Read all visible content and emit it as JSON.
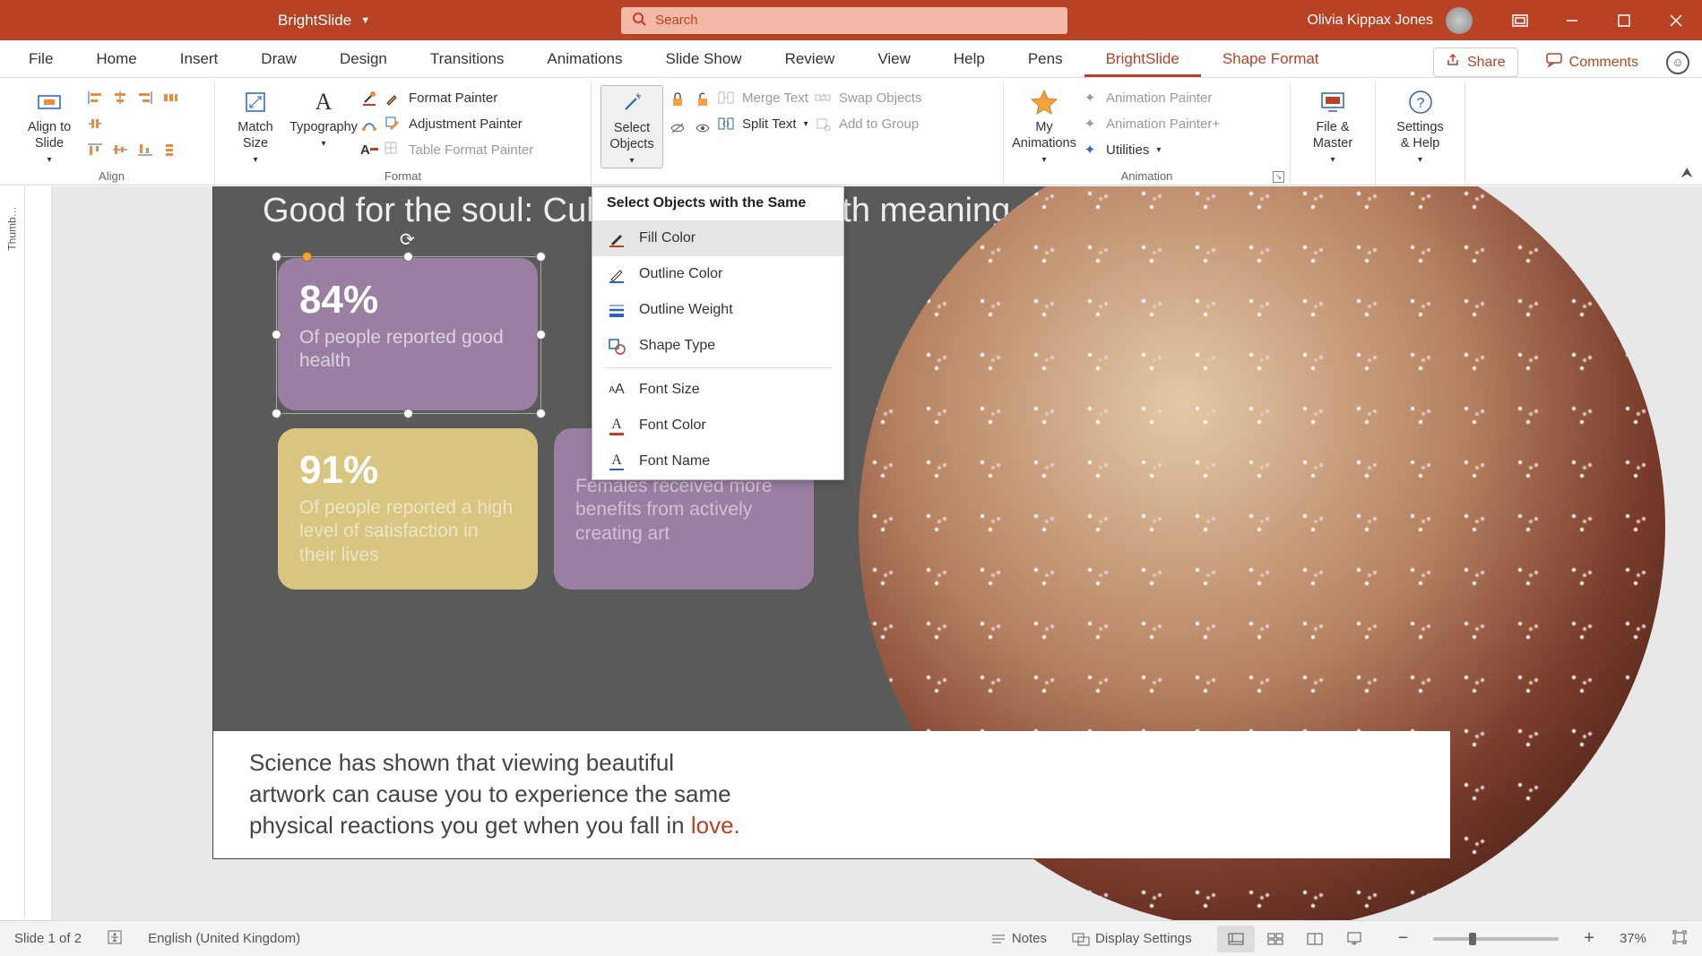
{
  "title_bar": {
    "app_name": "BrightSlide",
    "search_placeholder": "Search",
    "user_name": "Olivia Kippax Jones"
  },
  "tabs": {
    "file": "File",
    "home": "Home",
    "insert": "Insert",
    "draw": "Draw",
    "design": "Design",
    "transitions": "Transitions",
    "animations": "Animations",
    "slideshow": "Slide Show",
    "review": "Review",
    "view": "View",
    "help": "Help",
    "pens": "Pens",
    "brightslide": "BrightSlide",
    "shape_format": "Shape Format",
    "share": "Share",
    "comments": "Comments"
  },
  "ribbon": {
    "align": {
      "label": "Align",
      "align_to_slide": "Align to\nSlide"
    },
    "format": {
      "label": "Format",
      "match_size": "Match\nSize",
      "typography": "Typography",
      "format_painter": "Format Painter",
      "adjustment_painter": "Adjustment Painter",
      "table_format_painter": "Table Format Painter"
    },
    "select_objects": "Select\nObjects",
    "merge_text": "Merge Text",
    "split_text": "Split Text",
    "swap_objects": "Swap Objects",
    "add_to_group": "Add to Group",
    "my_animations": "My\nAnimations",
    "animation_label": "Animation",
    "animation_painter": "Animation Painter",
    "animation_painter_plus": "Animation Painter+",
    "utilities": "Utilities",
    "file_master": "File &\nMaster",
    "settings_help": "Settings\n& Help"
  },
  "dropdown": {
    "header": "Select Objects with the Same",
    "fill_color": "Fill Color",
    "outline_color": "Outline Color",
    "outline_weight": "Outline Weight",
    "shape_type": "Shape Type",
    "font_size": "Font Size",
    "font_color": "Font Color",
    "font_name": "Font Name"
  },
  "slide": {
    "title": "Good for the soul: Cultural activities with meaning",
    "card1_num": "84%",
    "card1_text": "Of people reported good health",
    "card2_num": "91%",
    "card2_text": "Of people reported a high level of satisfaction in their lives",
    "card3_text": "Females received more benefits from actively creating art",
    "footer_text_a": "Science has shown that viewing beautiful artwork can cause you to experience the same physical reactions you get when you fall in ",
    "footer_love": "love."
  },
  "status": {
    "slide_count": "Slide 1 of 2",
    "language": "English (United Kingdom)",
    "notes": "Notes",
    "display_settings": "Display Settings",
    "zoom": "37%"
  },
  "thumbs_label": "Thumb…"
}
